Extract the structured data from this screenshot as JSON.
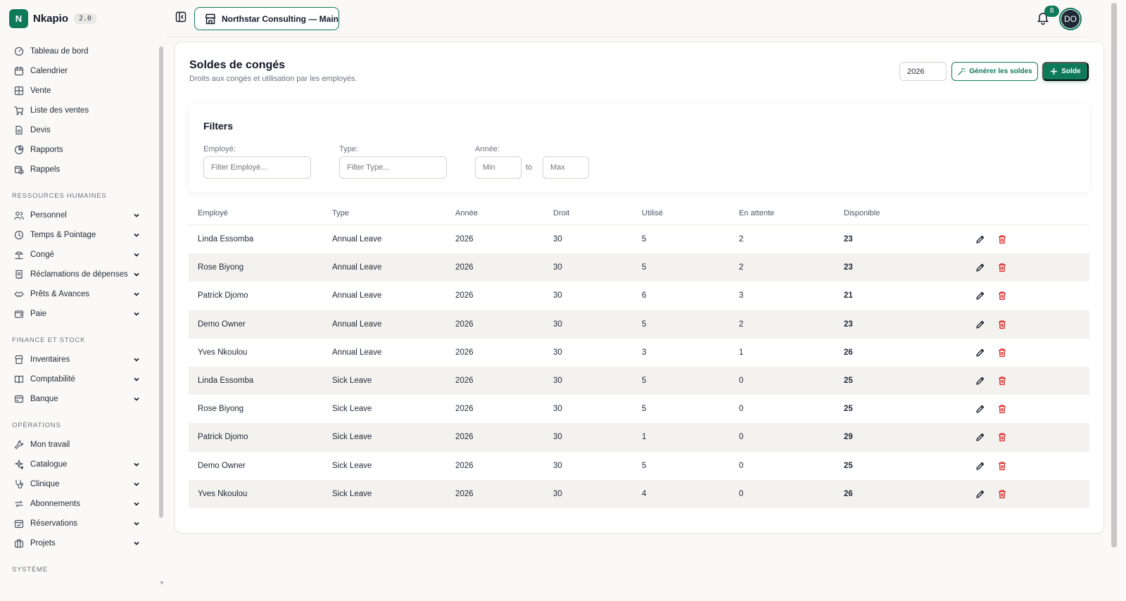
{
  "brand": {
    "name": "Nkapio",
    "version": "2.0",
    "logo_letter": "N"
  },
  "sidebar": {
    "top_items": [
      {
        "label": "Tableau de bord",
        "icon": "gauge-icon"
      },
      {
        "label": "Calendrier",
        "icon": "calendar-icon"
      },
      {
        "label": "Vente",
        "icon": "grid-icon"
      },
      {
        "label": "Liste des ventes",
        "icon": "cart-icon"
      },
      {
        "label": "Devis",
        "icon": "file-icon"
      },
      {
        "label": "Rapports",
        "icon": "pie-chart-icon"
      },
      {
        "label": "Rappels",
        "icon": "calendar-clock-icon"
      }
    ],
    "sections": [
      {
        "title": "RESSOURCES HUMAINES",
        "items": [
          {
            "label": "Personnel",
            "icon": "users-icon"
          },
          {
            "label": "Temps & Pointage",
            "icon": "clock-icon"
          },
          {
            "label": "Congé",
            "icon": "beach-icon"
          },
          {
            "label": "Réclamations de dépenses",
            "icon": "receipt-icon"
          },
          {
            "label": "Prêts & Avances",
            "icon": "handshake-icon"
          },
          {
            "label": "Paie",
            "icon": "wallet-icon"
          }
        ]
      },
      {
        "title": "FINANCE ET STOCK",
        "items": [
          {
            "label": "Inventaires",
            "icon": "store-icon"
          },
          {
            "label": "Comptabilité",
            "icon": "book-icon"
          },
          {
            "label": "Banque",
            "icon": "bank-card-icon"
          }
        ]
      },
      {
        "title": "OPÉRATIONS",
        "items": [
          {
            "label": "Mon travail",
            "icon": "wrench-icon"
          },
          {
            "label": "Catalogue",
            "icon": "sparkles-icon"
          },
          {
            "label": "Clinique",
            "icon": "stethoscope-icon"
          },
          {
            "label": "Abonnements",
            "icon": "repeat-icon"
          },
          {
            "label": "Réservations",
            "icon": "calendar-check-icon"
          },
          {
            "label": "Projets",
            "icon": "briefcase-icon"
          }
        ]
      },
      {
        "title": "SYSTÈME",
        "items": []
      }
    ]
  },
  "topbar": {
    "store_label": "Northstar Consulting — Main",
    "notification_count": "8",
    "avatar_initials": "DO"
  },
  "page": {
    "title": "Soldes de congés",
    "subtitle": "Droits aux congés et utilisation par les employés.",
    "year_value": "2026",
    "generate_label": "Générer les soldes",
    "add_label": "Solde"
  },
  "filters": {
    "title": "Filters",
    "employee_label": "Employé:",
    "employee_placeholder": "Filter Employé...",
    "type_label": "Type:",
    "type_placeholder": "Filter Type...",
    "year_label": "Année:",
    "min_placeholder": "Min",
    "to_label": "to",
    "max_placeholder": "Max"
  },
  "table": {
    "headers": [
      "Employé",
      "Type",
      "Année",
      "Droit",
      "Utilisé",
      "En attente",
      "Disponible"
    ],
    "rows": [
      [
        "Linda Essomba",
        "Annual Leave",
        "2026",
        "30",
        "5",
        "2",
        "23"
      ],
      [
        "Rose Biyong",
        "Annual Leave",
        "2026",
        "30",
        "5",
        "2",
        "23"
      ],
      [
        "Patrick Djomo",
        "Annual Leave",
        "2026",
        "30",
        "6",
        "3",
        "21"
      ],
      [
        "Demo Owner",
        "Annual Leave",
        "2026",
        "30",
        "5",
        "2",
        "23"
      ],
      [
        "Yves Nkoulou",
        "Annual Leave",
        "2026",
        "30",
        "3",
        "1",
        "26"
      ],
      [
        "Linda Essomba",
        "Sick Leave",
        "2026",
        "30",
        "5",
        "0",
        "25"
      ],
      [
        "Rose Biyong",
        "Sick Leave",
        "2026",
        "30",
        "5",
        "0",
        "25"
      ],
      [
        "Patrick Djomo",
        "Sick Leave",
        "2026",
        "30",
        "1",
        "0",
        "29"
      ],
      [
        "Demo Owner",
        "Sick Leave",
        "2026",
        "30",
        "5",
        "0",
        "25"
      ],
      [
        "Yves Nkoulou",
        "Sick Leave",
        "2026",
        "30",
        "4",
        "0",
        "26"
      ]
    ]
  },
  "colors": {
    "accent": "#0f7a5a",
    "danger": "#dc2626",
    "background": "#faf9f7"
  }
}
